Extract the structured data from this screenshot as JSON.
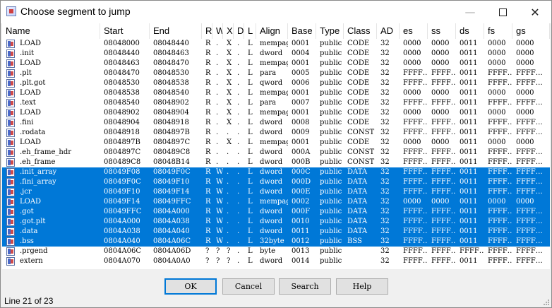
{
  "window": {
    "title": "Choose segment to jump"
  },
  "columns": [
    "Name",
    "Start",
    "End",
    "R",
    "W",
    "X",
    "D",
    "L",
    "Align",
    "Base",
    "Type",
    "Class",
    "AD",
    "es",
    "ss",
    "ds",
    "fs",
    "gs"
  ],
  "rows": [
    [
      "LOAD",
      "08048000",
      "08048440",
      "R",
      ".",
      "X",
      ".",
      "L",
      "mempage",
      "0001",
      "public",
      "CODE",
      "32",
      "0000",
      "0000",
      "0011",
      "0000",
      "0000"
    ],
    [
      ".init",
      "08048440",
      "08048463",
      "R",
      ".",
      "X",
      ".",
      "L",
      "dword",
      "0004",
      "public",
      "CODE",
      "32",
      "0000",
      "0000",
      "0011",
      "0000",
      "0000"
    ],
    [
      "LOAD",
      "08048463",
      "08048470",
      "R",
      ".",
      "X",
      ".",
      "L",
      "mempage",
      "0001",
      "public",
      "CODE",
      "32",
      "0000",
      "0000",
      "0011",
      "0000",
      "0000"
    ],
    [
      ".plt",
      "08048470",
      "08048530",
      "R",
      ".",
      "X",
      ".",
      "L",
      "para",
      "0005",
      "public",
      "CODE",
      "32",
      "FFFF…",
      "FFFF…",
      "0011",
      "FFFF…",
      "FFFF…"
    ],
    [
      ".plt.got",
      "08048530",
      "08048538",
      "R",
      ".",
      "X",
      ".",
      "L",
      "qword",
      "0006",
      "public",
      "CODE",
      "32",
      "FFFF…",
      "FFFF…",
      "0011",
      "FFFF…",
      "FFFF…"
    ],
    [
      "LOAD",
      "08048538",
      "08048540",
      "R",
      ".",
      "X",
      ".",
      "L",
      "mempage",
      "0001",
      "public",
      "CODE",
      "32",
      "0000",
      "0000",
      "0011",
      "0000",
      "0000"
    ],
    [
      ".text",
      "08048540",
      "08048902",
      "R",
      ".",
      "X",
      ".",
      "L",
      "para",
      "0007",
      "public",
      "CODE",
      "32",
      "FFFF…",
      "FFFF…",
      "0011",
      "FFFF…",
      "FFFF…"
    ],
    [
      "LOAD",
      "08048902",
      "08048904",
      "R",
      ".",
      "X",
      ".",
      "L",
      "mempage",
      "0001",
      "public",
      "CODE",
      "32",
      "0000",
      "0000",
      "0011",
      "0000",
      "0000"
    ],
    [
      ".fini",
      "08048904",
      "08048918",
      "R",
      ".",
      "X",
      ".",
      "L",
      "dword",
      "0008",
      "public",
      "CODE",
      "32",
      "FFFF…",
      "FFFF…",
      "0011",
      "FFFF…",
      "FFFF…"
    ],
    [
      ".rodata",
      "08048918",
      "0804897B",
      "R",
      ".",
      ".",
      ".",
      "L",
      "dword",
      "0009",
      "public",
      "CONST",
      "32",
      "FFFF…",
      "FFFF…",
      "0011",
      "FFFF…",
      "FFFF…"
    ],
    [
      "LOAD",
      "0804897B",
      "0804897C",
      "R",
      ".",
      "X",
      ".",
      "L",
      "mempage",
      "0001",
      "public",
      "CODE",
      "32",
      "0000",
      "0000",
      "0011",
      "0000",
      "0000"
    ],
    [
      ".eh_frame_hdr",
      "0804897C",
      "080489C8",
      "R",
      ".",
      ".",
      ".",
      "L",
      "dword",
      "000A",
      "public",
      "CONST",
      "32",
      "FFFF…",
      "FFFF…",
      "0011",
      "FFFF…",
      "FFFF…"
    ],
    [
      ".eh_frame",
      "080489C8",
      "08048B14",
      "R",
      ".",
      ".",
      ".",
      "L",
      "dword",
      "000B",
      "public",
      "CONST",
      "32",
      "FFFF…",
      "FFFF…",
      "0011",
      "FFFF…",
      "FFFF…"
    ],
    [
      ".init_array",
      "08049F08",
      "08049F0C",
      "R",
      "W",
      ".",
      ".",
      "L",
      "dword",
      "000C",
      "public",
      "DATA",
      "32",
      "FFFF…",
      "FFFF…",
      "0011",
      "FFFF…",
      "FFFF…"
    ],
    [
      ".fini_array",
      "08049F0C",
      "08049F10",
      "R",
      "W",
      ".",
      ".",
      "L",
      "dword",
      "000D",
      "public",
      "DATA",
      "32",
      "FFFF…",
      "FFFF…",
      "0011",
      "FFFF…",
      "FFFF…"
    ],
    [
      ".jcr",
      "08049F10",
      "08049F14",
      "R",
      "W",
      ".",
      ".",
      "L",
      "dword",
      "000E",
      "public",
      "DATA",
      "32",
      "FFFF…",
      "FFFF…",
      "0011",
      "FFFF…",
      "FFFF…"
    ],
    [
      "LOAD",
      "08049F14",
      "08049FFC",
      "R",
      "W",
      ".",
      ".",
      "L",
      "mempage",
      "0002",
      "public",
      "DATA",
      "32",
      "0000",
      "0000",
      "0011",
      "0000",
      "0000"
    ],
    [
      ".got",
      "08049FFC",
      "0804A000",
      "R",
      "W",
      ".",
      ".",
      "L",
      "dword",
      "000F",
      "public",
      "DATA",
      "32",
      "FFFF…",
      "FFFF…",
      "0011",
      "FFFF…",
      "FFFF…"
    ],
    [
      ".got.plt",
      "0804A000",
      "0804A038",
      "R",
      "W",
      ".",
      ".",
      "L",
      "dword",
      "0010",
      "public",
      "DATA",
      "32",
      "FFFF…",
      "FFFF…",
      "0011",
      "FFFF…",
      "FFFF…"
    ],
    [
      ".data",
      "0804A038",
      "0804A040",
      "R",
      "W",
      ".",
      ".",
      "L",
      "dword",
      "0011",
      "public",
      "DATA",
      "32",
      "FFFF…",
      "FFFF…",
      "0011",
      "FFFF…",
      "FFFF…"
    ],
    [
      ".bss",
      "0804A040",
      "0804A06C",
      "R",
      "W",
      ".",
      ".",
      "L",
      "32byte",
      "0012",
      "public",
      "BSS",
      "32",
      "FFFF…",
      "FFFF…",
      "0011",
      "FFFF…",
      "FFFF…"
    ],
    [
      ".prgend",
      "0804A06C",
      "0804A06D",
      "?",
      "?",
      "?",
      ".",
      "L",
      "byte",
      "0013",
      "public",
      "",
      "32",
      "FFFF…",
      "FFFF…",
      "FFFF…",
      "FFFF…",
      "FFFF…"
    ],
    [
      "extern",
      "0804A070",
      "0804A0A0",
      "?",
      "?",
      "?",
      ".",
      "L",
      "dword",
      "0014",
      "public",
      "",
      "32",
      "FFFF…",
      "FFFF…",
      "0011",
      "FFFF…",
      "FFFF…"
    ]
  ],
  "selected_rows": [
    13,
    14,
    15,
    16,
    17,
    18,
    19,
    20
  ],
  "buttons": {
    "ok": "OK",
    "cancel": "Cancel",
    "search": "Search",
    "help": "Help"
  },
  "status": "Line 21 of 23",
  "colors": {
    "selection": "#0078d7"
  }
}
